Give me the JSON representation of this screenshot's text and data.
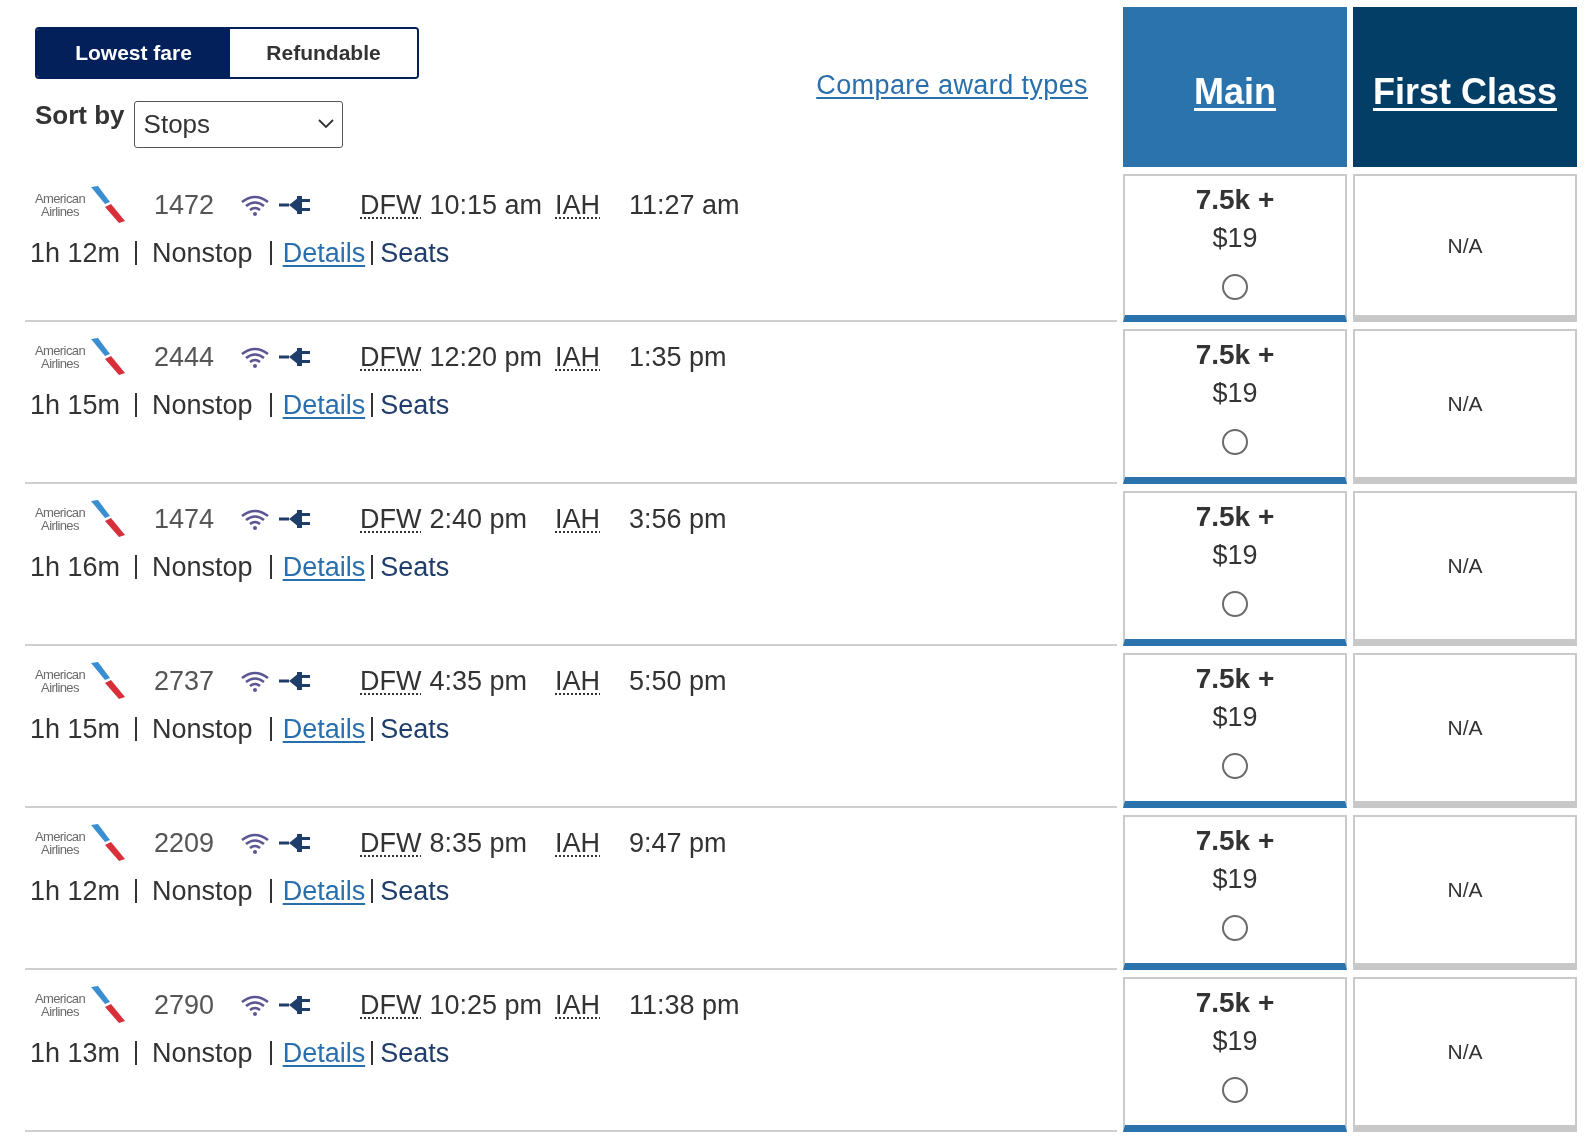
{
  "fare_toggle": [
    {
      "label": "Lowest fare",
      "selected": true
    },
    {
      "label": "Refundable",
      "selected": false
    }
  ],
  "sort": {
    "label": "Sort by",
    "value": "Stops"
  },
  "compare_link": "Compare award types",
  "fare_columns": [
    {
      "label": "Main",
      "color": "#2a73ad"
    },
    {
      "label": "First Class",
      "color": "#033e66"
    }
  ],
  "flights": [
    {
      "airline": "American Airlines",
      "flight_number": "1472",
      "origin": "DFW",
      "departure": "10:15 am",
      "destination": "IAH",
      "arrival": "11:27 am",
      "duration": "1h 12m",
      "stops": "Nonstop",
      "details_link": "Details",
      "seats_link": "Seats",
      "fares": [
        {
          "kind": "fare",
          "miles": "7.5k +",
          "price": "$19",
          "selected": false
        },
        {
          "kind": "unavailable",
          "text": "N/A"
        }
      ]
    },
    {
      "airline": "American Airlines",
      "flight_number": "2444",
      "origin": "DFW",
      "departure": "12:20 pm",
      "destination": "IAH",
      "arrival": "1:35 pm",
      "duration": "1h 15m",
      "stops": "Nonstop",
      "details_link": "Details",
      "seats_link": "Seats",
      "fares": [
        {
          "kind": "fare",
          "miles": "7.5k +",
          "price": "$19",
          "selected": false
        },
        {
          "kind": "unavailable",
          "text": "N/A"
        }
      ]
    },
    {
      "airline": "American Airlines",
      "flight_number": "1474",
      "origin": "DFW",
      "departure": "2:40 pm",
      "destination": "IAH",
      "arrival": "3:56 pm",
      "duration": "1h 16m",
      "stops": "Nonstop",
      "details_link": "Details",
      "seats_link": "Seats",
      "fares": [
        {
          "kind": "fare",
          "miles": "7.5k +",
          "price": "$19",
          "selected": false
        },
        {
          "kind": "unavailable",
          "text": "N/A"
        }
      ]
    },
    {
      "airline": "American Airlines",
      "flight_number": "2737",
      "origin": "DFW",
      "departure": "4:35 pm",
      "destination": "IAH",
      "arrival": "5:50 pm",
      "duration": "1h 15m",
      "stops": "Nonstop",
      "details_link": "Details",
      "seats_link": "Seats",
      "fares": [
        {
          "kind": "fare",
          "miles": "7.5k +",
          "price": "$19",
          "selected": false
        },
        {
          "kind": "unavailable",
          "text": "N/A"
        }
      ]
    },
    {
      "airline": "American Airlines",
      "flight_number": "2209",
      "origin": "DFW",
      "departure": "8:35 pm",
      "destination": "IAH",
      "arrival": "9:47 pm",
      "duration": "1h 12m",
      "stops": "Nonstop",
      "details_link": "Details",
      "seats_link": "Seats",
      "fares": [
        {
          "kind": "fare",
          "miles": "7.5k +",
          "price": "$19",
          "selected": false
        },
        {
          "kind": "unavailable",
          "text": "N/A"
        }
      ]
    },
    {
      "airline": "American Airlines",
      "flight_number": "2790",
      "origin": "DFW",
      "departure": "10:25 pm",
      "destination": "IAH",
      "arrival": "11:38 pm",
      "duration": "1h 13m",
      "stops": "Nonstop",
      "details_link": "Details",
      "seats_link": "Seats",
      "fares": [
        {
          "kind": "fare",
          "miles": "7.5k +",
          "price": "$19",
          "selected": false
        },
        {
          "kind": "unavailable",
          "text": "N/A"
        }
      ]
    }
  ]
}
